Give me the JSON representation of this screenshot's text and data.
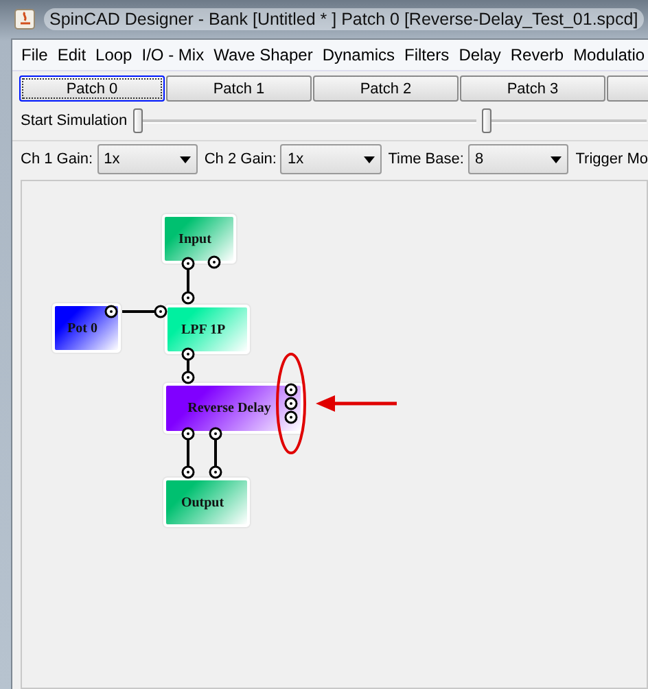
{
  "window": {
    "title": "SpinCAD Designer - Bank [Untitled * ] Patch 0 [Reverse-Delay_Test_01.spcd]"
  },
  "menu": [
    "File",
    "Edit",
    "Loop",
    "I/O - Mix",
    "Wave Shaper",
    "Dynamics",
    "Filters",
    "Delay",
    "Reverb",
    "Modulatio"
  ],
  "tabs": [
    {
      "label": "Patch 0",
      "selected": true
    },
    {
      "label": "Patch 1",
      "selected": false
    },
    {
      "label": "Patch 2",
      "selected": false
    },
    {
      "label": "Patch 3",
      "selected": false
    },
    {
      "selected": false
    }
  ],
  "simulation": {
    "label": "Start Simulation",
    "sliders": [
      {
        "level": 0
      },
      {
        "level": 0
      }
    ]
  },
  "controls": [
    {
      "label": "Ch 1 Gain:",
      "value": "1x"
    },
    {
      "label": "Ch 2 Gain:",
      "value": "1x"
    },
    {
      "label": "Time Base:",
      "value": "8"
    },
    {
      "label": "Trigger Mo"
    }
  ],
  "nodes": [
    {
      "name": "Input",
      "color": "#00c070"
    },
    {
      "name": "Pot 0",
      "color": "#0000ff"
    },
    {
      "name": "LPF 1P",
      "color": "#00f0a0"
    },
    {
      "name": "Reverse Delay",
      "color": "#8000ff"
    },
    {
      "name": "Output",
      "color": "#00c070"
    }
  ]
}
